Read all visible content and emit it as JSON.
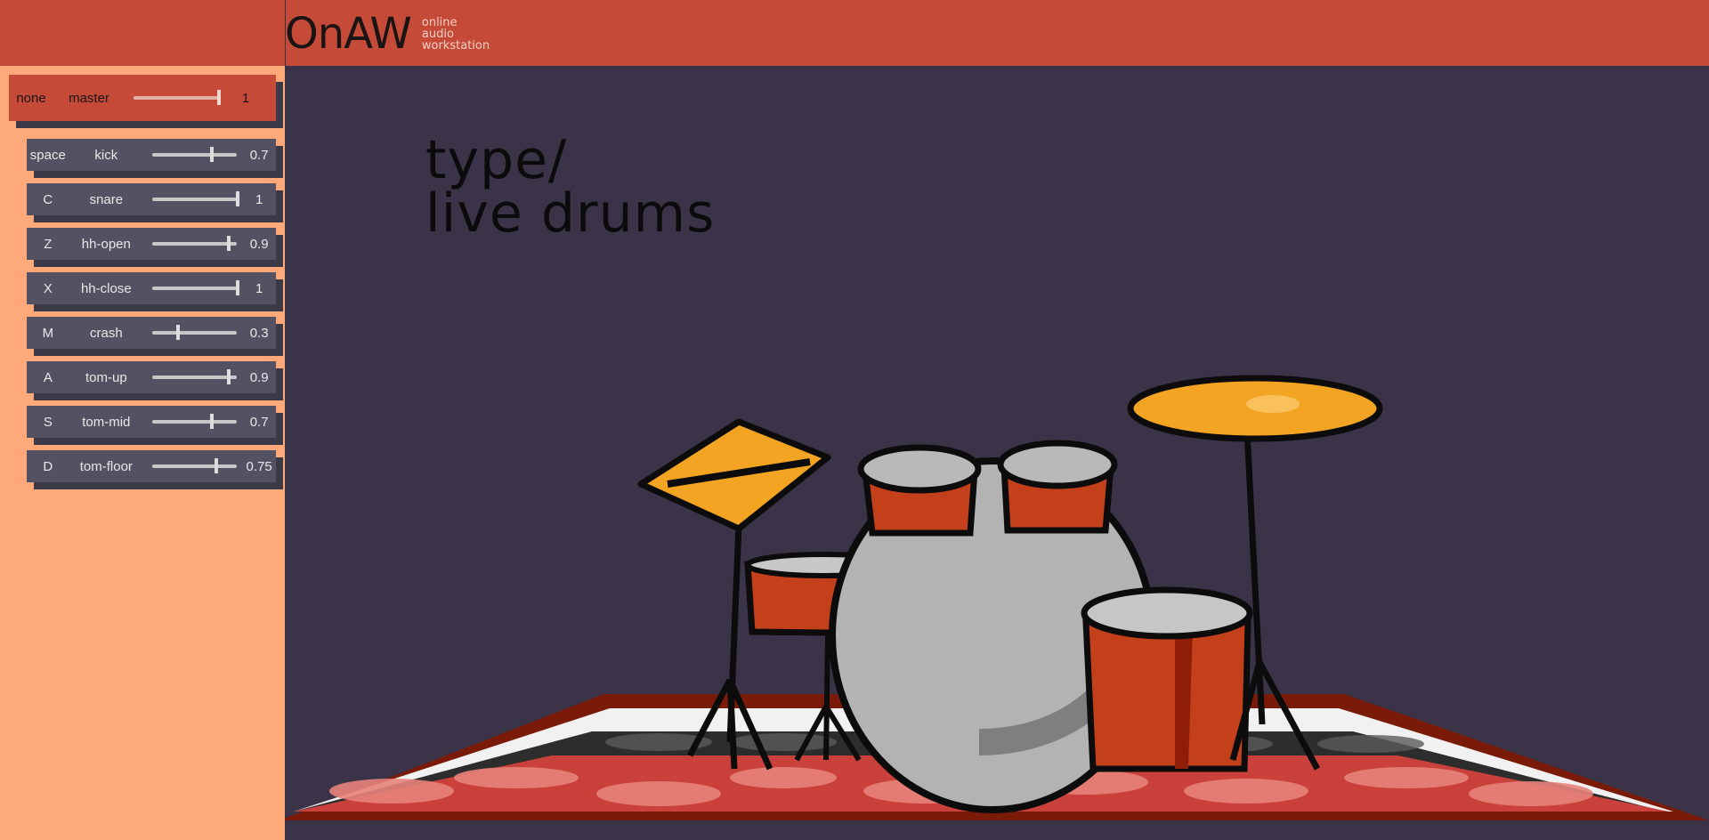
{
  "app": {
    "logo": "OnAW",
    "logo_sub": [
      "online",
      "audio",
      "workstation"
    ]
  },
  "master": {
    "key": "none",
    "name": "master",
    "value": "1",
    "level": 1
  },
  "tracks": [
    {
      "key": "space",
      "name": "kick",
      "value": "0.7",
      "level": 0.7
    },
    {
      "key": "C",
      "name": "snare",
      "value": "1",
      "level": 1
    },
    {
      "key": "Z",
      "name": "hh-open",
      "value": "0.9",
      "level": 0.9
    },
    {
      "key": "X",
      "name": "hh-close",
      "value": "1",
      "level": 1
    },
    {
      "key": "M",
      "name": "crash",
      "value": "0.3",
      "level": 0.3
    },
    {
      "key": "A",
      "name": "tom-up",
      "value": "0.9",
      "level": 0.9
    },
    {
      "key": "S",
      "name": "tom-mid",
      "value": "0.7",
      "level": 0.7
    },
    {
      "key": "D",
      "name": "tom-floor",
      "value": "0.75",
      "level": 0.75
    }
  ],
  "heading": {
    "line1": "type/",
    "line2": "live drums"
  },
  "colors": {
    "topbar": "#c64a38",
    "sidebar": "#fda97a",
    "stage": "#3b3448",
    "track": "#545262"
  }
}
